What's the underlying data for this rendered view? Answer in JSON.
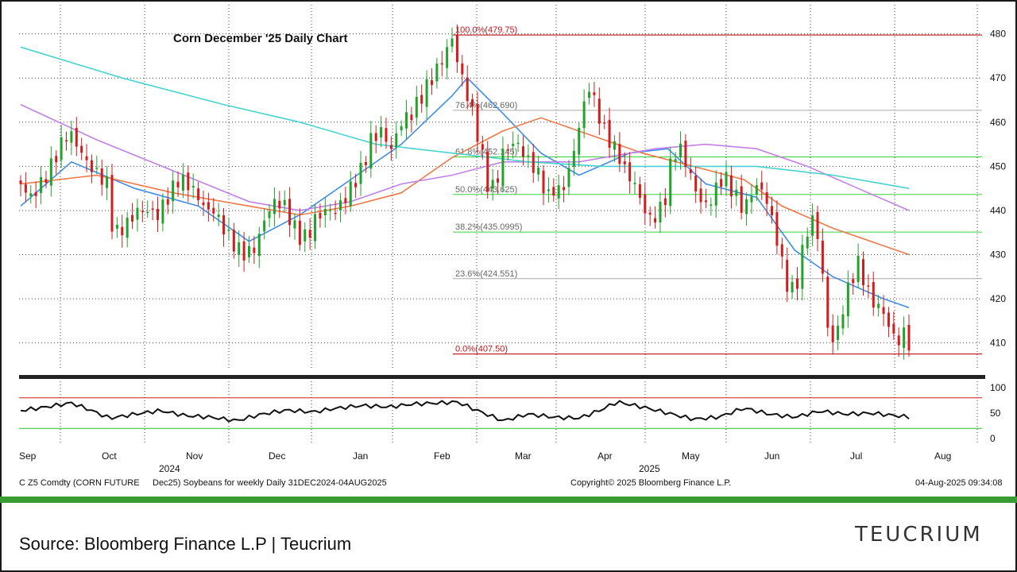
{
  "chart_data": {
    "type": "candlestick",
    "title": "Corn December '25 Daily Chart",
    "y_axis": {
      "ticks": [
        410,
        420,
        430,
        440,
        450,
        460,
        470,
        480
      ],
      "range": [
        404,
        483
      ]
    },
    "x_axis": {
      "months": [
        "Sep",
        "Oct",
        "Nov",
        "Dec",
        "Jan",
        "Feb",
        "Mar",
        "Apr",
        "May",
        "Jun",
        "Jul",
        "Aug"
      ],
      "years": [
        "2024",
        "2025"
      ]
    },
    "fib_levels": [
      {
        "label": "100.0%(479.75)",
        "value": 479.75,
        "color": "#c0161b"
      },
      {
        "label": "76.4%(462.690)",
        "value": 462.69,
        "color": "#aaaaaa"
      },
      {
        "label": "61.8%(452.145)",
        "value": 452.145,
        "color": "#39d13a"
      },
      {
        "label": "50.0%(443.625)",
        "value": 443.625,
        "color": "#39d13a"
      },
      {
        "label": "38.2%(435.0995)",
        "value": 435.0995,
        "color": "#39d13a"
      },
      {
        "label": "23.6%(424.551)",
        "value": 424.551,
        "color": "#aaaaaa"
      },
      {
        "label": "0.0%(407.50)",
        "value": 407.5,
        "color": "#c0161b"
      }
    ],
    "close_series": [
      [
        0,
        446
      ],
      [
        4,
        443
      ],
      [
        8,
        446
      ],
      [
        12,
        450
      ],
      [
        15,
        454
      ],
      [
        19,
        458
      ],
      [
        23,
        454
      ],
      [
        27,
        450
      ],
      [
        31,
        448
      ],
      [
        34,
        446
      ],
      [
        35,
        438
      ],
      [
        38,
        435
      ],
      [
        42,
        437
      ],
      [
        46,
        440
      ],
      [
        50,
        440
      ],
      [
        54,
        439
      ],
      [
        58,
        443
      ],
      [
        62,
        447
      ],
      [
        66,
        446
      ],
      [
        70,
        443
      ],
      [
        73,
        440
      ],
      [
        76,
        440
      ],
      [
        79,
        437
      ],
      [
        82,
        434
      ],
      [
        86,
        431
      ],
      [
        89,
        430
      ],
      [
        93,
        432
      ],
      [
        96,
        438
      ],
      [
        100,
        442
      ],
      [
        104,
        441
      ],
      [
        107,
        437
      ],
      [
        110,
        434
      ],
      [
        113,
        434
      ],
      [
        116,
        438
      ],
      [
        120,
        440
      ],
      [
        124,
        440
      ],
      [
        127,
        442
      ],
      [
        131,
        446
      ],
      [
        135,
        450
      ],
      [
        138,
        456
      ],
      [
        142,
        458
      ],
      [
        146,
        454
      ],
      [
        150,
        460
      ],
      [
        154,
        462
      ],
      [
        158,
        466
      ],
      [
        162,
        470
      ],
      [
        166,
        474
      ],
      [
        170,
        479
      ],
      [
        172,
        474
      ],
      [
        175,
        468
      ],
      [
        178,
        462
      ],
      [
        181,
        455
      ],
      [
        184,
        446
      ],
      [
        187,
        445
      ],
      [
        190,
        453
      ],
      [
        193,
        455
      ],
      [
        196,
        455
      ],
      [
        199,
        452
      ],
      [
        202,
        450
      ],
      [
        205,
        447
      ],
      [
        208,
        443
      ],
      [
        210,
        445
      ],
      [
        213,
        444
      ],
      [
        216,
        449
      ],
      [
        219,
        456
      ],
      [
        221,
        462
      ],
      [
        224,
        468
      ],
      [
        227,
        463
      ],
      [
        230,
        458
      ],
      [
        233,
        455
      ],
      [
        236,
        452
      ],
      [
        239,
        448
      ],
      [
        242,
        446
      ],
      [
        245,
        441
      ],
      [
        248,
        438
      ],
      [
        251,
        439
      ],
      [
        254,
        443
      ],
      [
        256,
        450
      ],
      [
        259,
        455
      ],
      [
        262,
        451
      ],
      [
        265,
        446
      ],
      [
        268,
        442
      ],
      [
        271,
        441
      ],
      [
        274,
        445
      ],
      [
        277,
        448
      ],
      [
        279,
        446
      ],
      [
        282,
        443
      ],
      [
        285,
        440
      ],
      [
        288,
        444
      ],
      [
        291,
        446
      ],
      [
        294,
        442
      ],
      [
        297,
        436
      ],
      [
        300,
        428
      ],
      [
        303,
        421
      ],
      [
        306,
        424
      ],
      [
        309,
        434
      ],
      [
        312,
        438
      ],
      [
        315,
        432
      ],
      [
        318,
        413
      ],
      [
        321,
        410
      ],
      [
        324,
        418
      ],
      [
        327,
        424
      ],
      [
        330,
        428
      ],
      [
        333,
        423
      ],
      [
        336,
        419
      ],
      [
        339,
        418
      ],
      [
        342,
        414
      ],
      [
        345,
        410
      ],
      [
        348,
        412
      ],
      [
        350,
        410
      ]
    ],
    "moving_averages": [
      {
        "name": "ma_fast",
        "color": "#3f8de8",
        "points": [
          [
            0,
            441
          ],
          [
            20,
            451
          ],
          [
            45,
            445
          ],
          [
            70,
            441
          ],
          [
            90,
            433
          ],
          [
            110,
            439
          ],
          [
            130,
            447
          ],
          [
            150,
            455
          ],
          [
            170,
            466
          ],
          [
            176,
            470
          ],
          [
            190,
            462
          ],
          [
            205,
            453
          ],
          [
            220,
            448
          ],
          [
            240,
            453
          ],
          [
            255,
            454
          ],
          [
            270,
            446
          ],
          [
            290,
            443
          ],
          [
            305,
            431
          ],
          [
            320,
            425
          ],
          [
            340,
            420
          ],
          [
            350,
            418
          ]
        ]
      },
      {
        "name": "ma_mid",
        "color": "#ee7848",
        "points": [
          [
            0,
            446
          ],
          [
            30,
            448
          ],
          [
            60,
            444
          ],
          [
            90,
            441
          ],
          [
            110,
            439
          ],
          [
            130,
            441
          ],
          [
            150,
            444
          ],
          [
            170,
            452
          ],
          [
            190,
            458
          ],
          [
            205,
            461
          ],
          [
            225,
            457
          ],
          [
            245,
            453
          ],
          [
            265,
            450
          ],
          [
            285,
            447
          ],
          [
            300,
            441
          ],
          [
            320,
            436
          ],
          [
            340,
            432
          ],
          [
            350,
            430
          ]
        ]
      },
      {
        "name": "ma_slow",
        "color": "#c281e8",
        "points": [
          [
            0,
            464
          ],
          [
            30,
            456
          ],
          [
            60,
            449
          ],
          [
            90,
            442
          ],
          [
            110,
            440
          ],
          [
            130,
            442
          ],
          [
            150,
            446
          ],
          [
            170,
            448
          ],
          [
            190,
            451
          ],
          [
            220,
            451
          ],
          [
            250,
            454
          ],
          [
            270,
            455
          ],
          [
            290,
            454
          ],
          [
            310,
            450
          ],
          [
            330,
            445
          ],
          [
            350,
            440
          ]
        ]
      },
      {
        "name": "ma_long",
        "color": "#45d4d0",
        "points": [
          [
            0,
            477
          ],
          [
            40,
            470
          ],
          [
            80,
            464
          ],
          [
            110,
            460
          ],
          [
            140,
            455
          ],
          [
            170,
            453
          ],
          [
            200,
            451
          ],
          [
            230,
            450
          ],
          [
            260,
            450
          ],
          [
            290,
            450
          ],
          [
            320,
            448
          ],
          [
            340,
            446
          ],
          [
            350,
            445
          ]
        ]
      }
    ],
    "rsi": {
      "ticks": [
        0,
        50,
        100
      ],
      "upper": 80,
      "lower": 20,
      "points": [
        [
          0,
          55
        ],
        [
          10,
          62
        ],
        [
          20,
          70
        ],
        [
          28,
          55
        ],
        [
          35,
          40
        ],
        [
          45,
          48
        ],
        [
          55,
          55
        ],
        [
          65,
          45
        ],
        [
          75,
          42
        ],
        [
          85,
          35
        ],
        [
          95,
          48
        ],
        [
          105,
          56
        ],
        [
          115,
          52
        ],
        [
          125,
          60
        ],
        [
          135,
          65
        ],
        [
          145,
          62
        ],
        [
          155,
          68
        ],
        [
          165,
          70
        ],
        [
          172,
          72
        ],
        [
          180,
          55
        ],
        [
          190,
          35
        ],
        [
          200,
          48
        ],
        [
          210,
          42
        ],
        [
          220,
          40
        ],
        [
          228,
          55
        ],
        [
          235,
          72
        ],
        [
          245,
          62
        ],
        [
          255,
          50
        ],
        [
          265,
          38
        ],
        [
          275,
          42
        ],
        [
          285,
          60
        ],
        [
          295,
          48
        ],
        [
          305,
          42
        ],
        [
          315,
          54
        ],
        [
          325,
          48
        ],
        [
          335,
          50
        ],
        [
          345,
          45
        ],
        [
          350,
          42
        ]
      ]
    }
  },
  "info_bar": {
    "ticker": "C Z5 Comdty (CORN FUTURE",
    "desc": "Dec25) Soybeans for weekly  Daily 31DEC2024-04AUG2025",
    "copyright": "Copyright© 2025 Bloomberg Finance L.P.",
    "timestamp": "04-Aug-2025 09:34:08"
  },
  "footer": {
    "source": "Source: Bloomberg Finance L.P | Teucrium",
    "logo": "TEUCRIUM"
  }
}
